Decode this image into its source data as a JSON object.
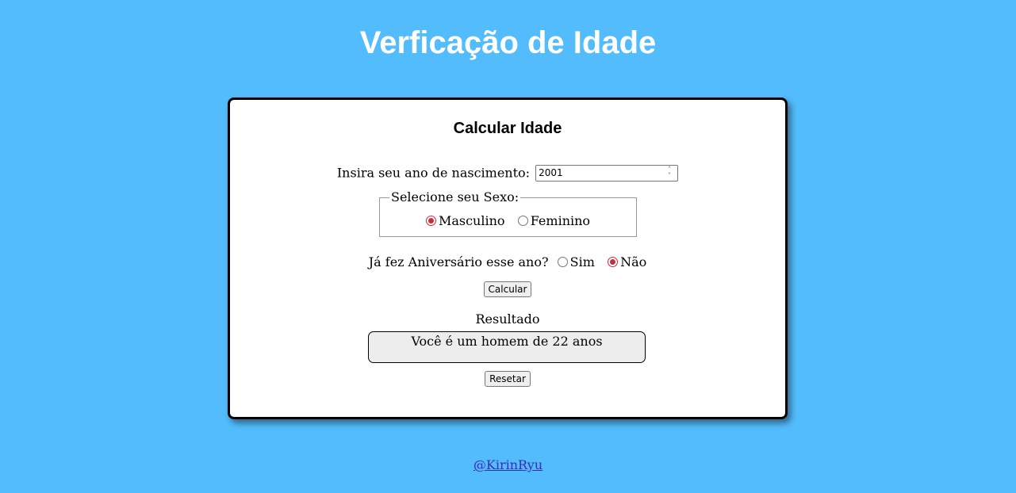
{
  "page": {
    "title": "Verficação de Idade",
    "footer_link": "@KirinRyu"
  },
  "card": {
    "title": "Calcular Idade",
    "birth_year_label": "Insira seu ano de nascimento:",
    "birth_year_value": "2001",
    "sex_group": {
      "legend": "Selecione seu Sexo:",
      "options": [
        {
          "label": "Masculino",
          "checked": true
        },
        {
          "label": "Feminino",
          "checked": false
        }
      ]
    },
    "birthday_question": {
      "label": "Já fez Aniversário esse ano?",
      "options": [
        {
          "label": "Sim",
          "checked": false
        },
        {
          "label": "Não",
          "checked": true
        }
      ]
    },
    "calculate_label": "Calcular",
    "result_label": "Resultado",
    "result_text": "Você é um homem de 22 anos",
    "reset_label": "Resetar"
  },
  "colors": {
    "background": "#52bcfc",
    "card_bg": "#ffffff",
    "radio_accent": "#cc2c3a",
    "link": "#3a2cb8",
    "result_bg": "#ededed"
  },
  "icons": {
    "spinner_up": "chevron-up-icon",
    "spinner_down": "chevron-down-icon"
  }
}
